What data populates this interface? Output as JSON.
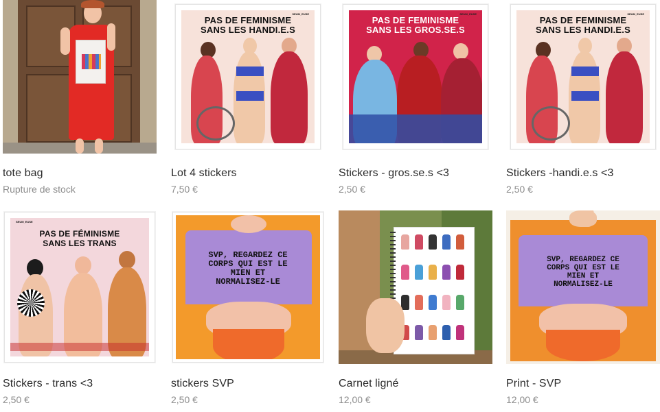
{
  "products": [
    {
      "title": "tote bag",
      "sub": "Rupture de stock",
      "art": "photo-tote"
    },
    {
      "title": "Lot 4 stickers",
      "sub": "7,50 €",
      "art": "poster",
      "headline": "PAS DE FEMINISME\nSANS LES HANDI.E.S",
      "bg": "#f7e2da"
    },
    {
      "title": "Stickers - gros.se.s <3",
      "sub": "2,50 €",
      "art": "poster",
      "headline": "PAS DE FEMINISME\nSANS LES GROS.SE.S",
      "bg": "#d1234a"
    },
    {
      "title": "Stickers -handi.e.s <3",
      "sub": "2,50 €",
      "art": "poster",
      "headline": "PAS DE FEMINISME\nSANS LES HANDI.E.S",
      "bg": "#f7e2da"
    },
    {
      "title": "Stickers - trans <3",
      "sub": "2,50 €",
      "art": "poster",
      "headline": "PAS DE FÉMINISME\nSANS LES TRANS",
      "bg": "#f3d7dc"
    },
    {
      "title": "stickers SVP",
      "sub": "2,50 €",
      "art": "svp",
      "headline": "SVP, REGARDEZ CE\nCORPS QUI EST LE\nMIEN ET\nNORMALISEZ-LE"
    },
    {
      "title": "Carnet ligné",
      "sub": "12,00 €",
      "art": "notebook"
    },
    {
      "title": "Print - SVP",
      "sub": "12,00 €",
      "art": "svp-photo",
      "headline": "SVP, REGARDEZ CE\nCORPS QUI EST LE\nMIEN ET\nNORMALISEZ-LE"
    }
  ],
  "poster_tag": "SEUM_EUSE",
  "colors": {
    "price": "#8c8c8c",
    "title": "#2b2b2b",
    "orange": "#f39a2b",
    "purple": "#a98ad6"
  }
}
